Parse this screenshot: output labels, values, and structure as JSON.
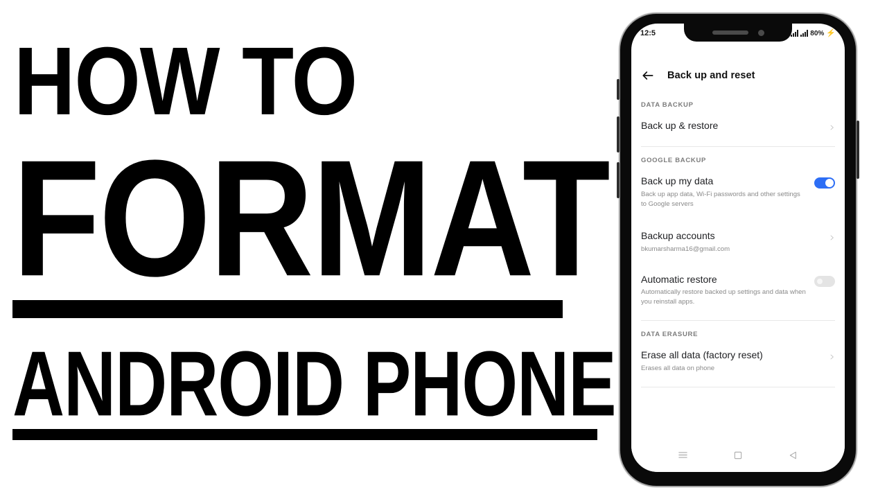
{
  "thumbnail": {
    "line1": "HOW TO",
    "line2": "FORMAT",
    "line3": "ANDROID PHONE",
    "text_color": "#000000",
    "background": "#ffffff"
  },
  "phone": {
    "status_bar": {
      "time": "12:5",
      "battery_percent": "80%",
      "charging_icon": "bolt-icon",
      "signal_icon": "signal-bars-icon",
      "signal_icon_secondary": "signal-bars-icon"
    },
    "header": {
      "back_icon": "back-arrow-icon",
      "title": "Back up and reset"
    },
    "sections": [
      {
        "header": "DATA BACKUP",
        "rows": [
          {
            "title": "Back up & restore",
            "subtitle": "",
            "control": "chevron"
          }
        ]
      },
      {
        "header": "GOOGLE BACKUP",
        "rows": [
          {
            "title": "Back up my data",
            "subtitle": "Back up app data, Wi-Fi passwords and other settings to Google servers",
            "control": "toggle-on"
          },
          {
            "title": "Backup accounts",
            "subtitle": "bkumarsharma16@gmail.com",
            "control": "chevron"
          },
          {
            "title": "Automatic restore",
            "subtitle": "Automatically restore backed up settings and data when you reinstall apps.",
            "control": "toggle-off"
          }
        ]
      },
      {
        "header": "DATA ERASURE",
        "rows": [
          {
            "title": "Erase all data (factory reset)",
            "subtitle": "Erases all data on phone",
            "control": "chevron"
          }
        ]
      }
    ],
    "nav_bar": {
      "recents_icon": "menu-icon",
      "home_icon": "home-square-icon",
      "back_icon": "back-triangle-icon"
    },
    "colors": {
      "toggle_on": "#2d6ef5",
      "toggle_off": "#e4e4e4",
      "section_header": "#7c7c7c",
      "row_title": "#202124",
      "row_subtitle": "#8a8a8a",
      "frame": "#0a0a0a"
    }
  }
}
